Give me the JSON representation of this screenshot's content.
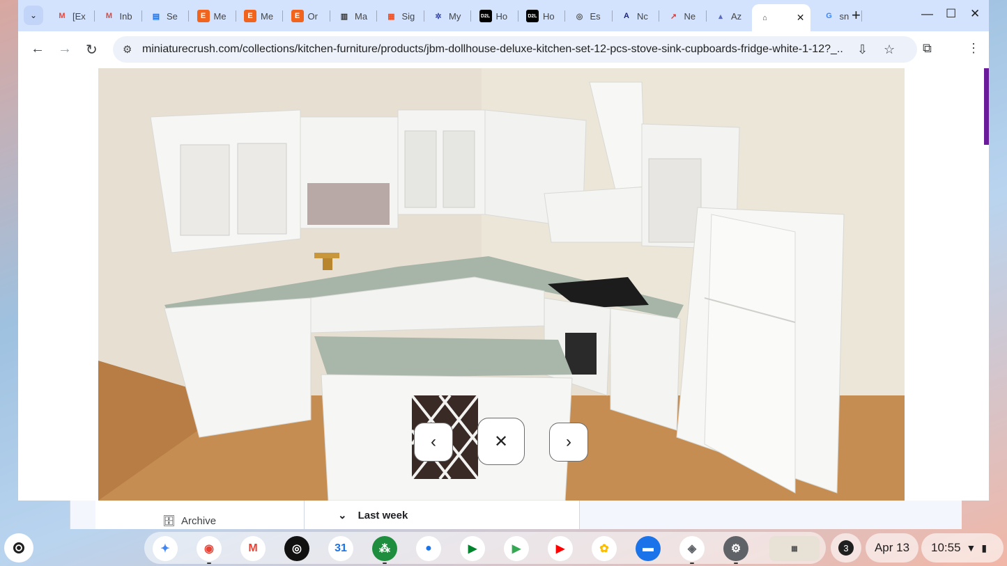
{
  "background_app": {
    "archive_label": "Archive",
    "last_week_label": "Last week"
  },
  "tabs": [
    {
      "favicon": "gmail-icon",
      "label": "[Ex",
      "color": "#ea4335"
    },
    {
      "favicon": "gmail-icon",
      "label": "Inb",
      "color": "#ea4335"
    },
    {
      "favicon": "docs-icon",
      "label": "Se",
      "color": "#1a73e8"
    },
    {
      "favicon": "etsy-icon",
      "label": "Me",
      "color": "#f1641e"
    },
    {
      "favicon": "etsy-icon",
      "label": "Me",
      "color": "#f1641e"
    },
    {
      "favicon": "etsy-icon",
      "label": "Or",
      "color": "#f1641e"
    },
    {
      "favicon": "store-icon",
      "label": "Ma",
      "color": "#333333"
    },
    {
      "favicon": "microsoft-icon",
      "label": "Sig",
      "color": "#f25022"
    },
    {
      "favicon": "pinwheel-icon",
      "label": "My",
      "color": "#3949ab"
    },
    {
      "favicon": "d2l-icon",
      "label": "Ho",
      "color": "#000000"
    },
    {
      "favicon": "d2l-icon",
      "label": "Ho",
      "color": "#000000"
    },
    {
      "favicon": "es-icon",
      "label": "Es",
      "color": "#555555"
    },
    {
      "favicon": "a-icon",
      "label": "Nc",
      "color": "#1a237e"
    },
    {
      "favicon": "graph-icon",
      "label": "Ne",
      "color": "#e53935"
    },
    {
      "favicon": "az-icon",
      "label": "Az",
      "color": "#5c6bc0"
    },
    {
      "favicon": "store-outline-icon",
      "label": "",
      "color": "#444444",
      "active": true
    },
    {
      "favicon": "google-icon",
      "label": "sn",
      "color": "#4285f4"
    }
  ],
  "new_tab_symbol": "+",
  "window_controls": {
    "minimize": "—",
    "maximize": "☐",
    "close": "✕"
  },
  "toolbar": {
    "back": "←",
    "forward": "→",
    "reload": "↻",
    "url": "miniaturecrush.com/collections/kitchen-furniture/products/jbm-dollhouse-deluxe-kitchen-set-12-pcs-stove-sink-cupboards-fridge-white-1-12?_..."
  },
  "lightbox": {
    "prev": "‹",
    "close": "✕",
    "next": "›",
    "image_alt": "JBM Dollhouse Deluxe Kitchen Set 12 pcs stove sink cupboards fridge white 1:12"
  },
  "shelf": {
    "apps": [
      {
        "name": "gemini-icon",
        "bg": "#ffffff",
        "fg": "#4285f4",
        "glyph": "✦"
      },
      {
        "name": "chrome-icon",
        "bg": "#ffffff",
        "fg": "#ea4335",
        "glyph": "◉",
        "running": true
      },
      {
        "name": "gmail-app-icon",
        "bg": "#ffffff",
        "fg": "#ea4335",
        "glyph": "M"
      },
      {
        "name": "podcast-icon",
        "bg": "#111111",
        "fg": "#ffffff",
        "glyph": "◎"
      },
      {
        "name": "calendar-icon",
        "bg": "#ffffff",
        "fg": "#1a73e8",
        "glyph": "31"
      },
      {
        "name": "workspace-icon",
        "bg": "#1e8e3e",
        "fg": "#ffffff",
        "glyph": "⁂",
        "running": true
      },
      {
        "name": "chat-icon",
        "bg": "#ffffff",
        "fg": "#1a73e8",
        "glyph": "●"
      },
      {
        "name": "meet-icon",
        "bg": "#ffffff",
        "fg": "#00832d",
        "glyph": "▶"
      },
      {
        "name": "play-store-icon",
        "bg": "#ffffff",
        "fg": "#34a853",
        "glyph": "▶"
      },
      {
        "name": "youtube-icon",
        "bg": "#ffffff",
        "fg": "#ff0000",
        "glyph": "▶"
      },
      {
        "name": "photos-icon",
        "bg": "#ffffff",
        "fg": "#fbbc04",
        "glyph": "✿"
      },
      {
        "name": "files-icon",
        "bg": "#1a73e8",
        "fg": "#ffffff",
        "glyph": "▬"
      },
      {
        "name": "camera-icon",
        "bg": "#ffffff",
        "fg": "#5f6368",
        "glyph": "◈",
        "running": true
      },
      {
        "name": "settings-icon",
        "bg": "#5f6368",
        "fg": "#ffffff",
        "glyph": "⚙",
        "running": true
      }
    ],
    "notification_count": "3",
    "date": "Apr 13",
    "time": "10:55"
  }
}
